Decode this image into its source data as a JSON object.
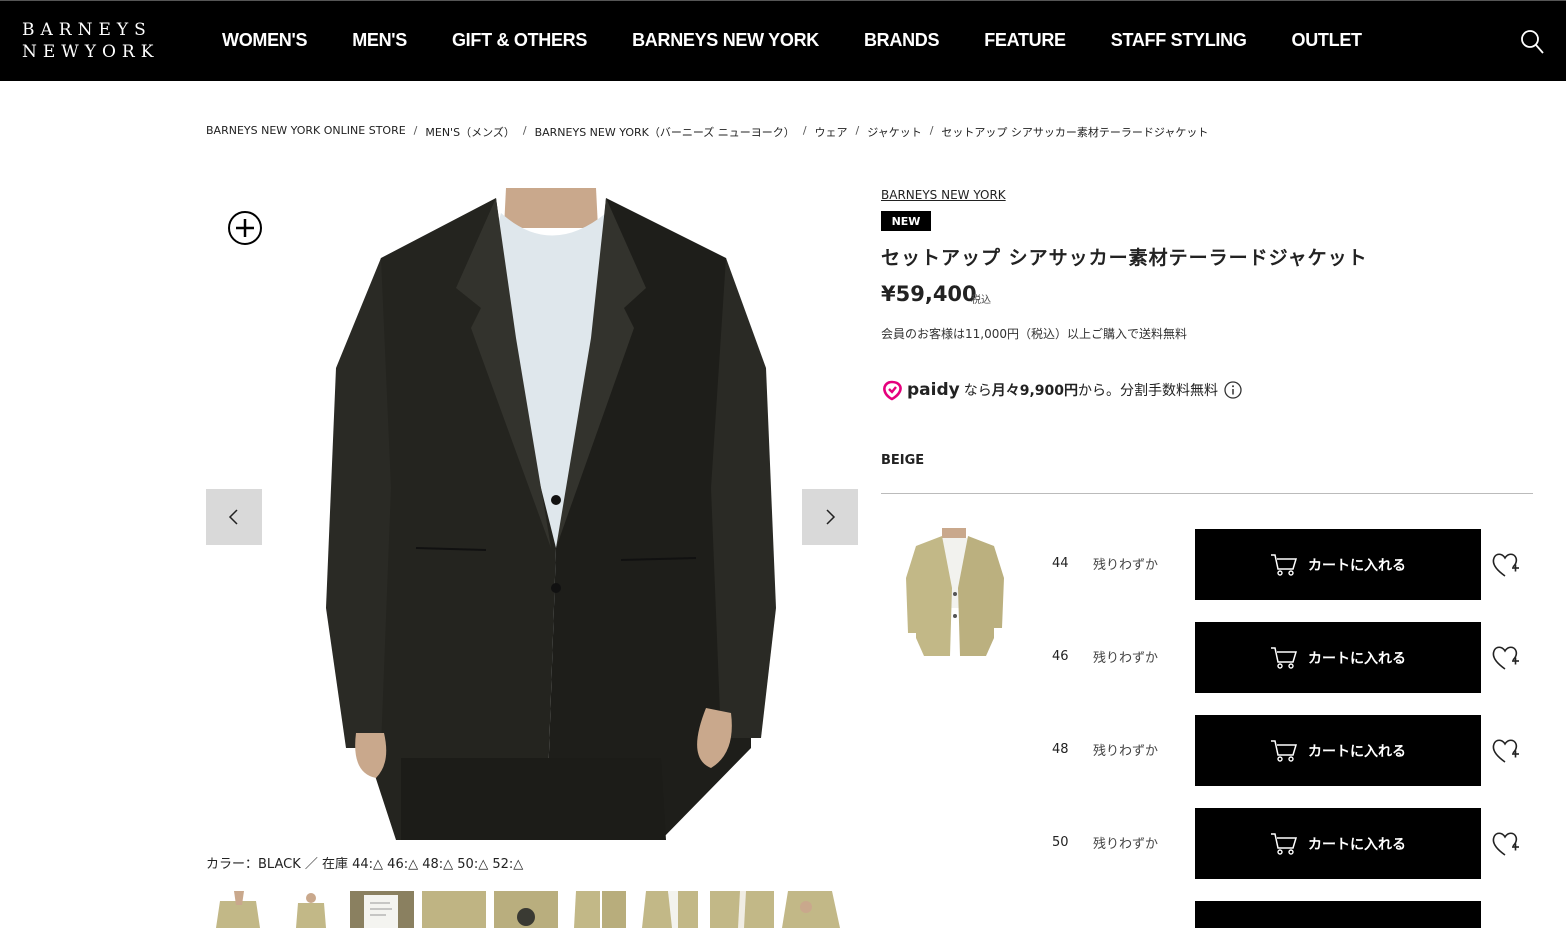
{
  "header": {
    "logo_line1": "BARNEYS",
    "logo_line2": "NEWYORK",
    "nav": [
      "WOMEN'S",
      "MEN'S",
      "GIFT & OTHERS",
      "BARNEYS NEW YORK",
      "BRANDS",
      "FEATURE",
      "STAFF STYLING",
      "OUTLET"
    ],
    "search_icon": "search-icon"
  },
  "breadcrumb": [
    "BARNEYS NEW YORK ONLINE STORE",
    "MEN'S（メンズ）",
    "BARNEYS NEW YORK（バーニーズ ニューヨーク）",
    "ウェア",
    "ジャケット",
    "セットアップ シアサッカー素材テーラードジャケット"
  ],
  "breadcrumb_sep": "/",
  "gallery": {
    "color_stock": "カラー：BLACK ／ 在庫 44:△ 46:△ 48:△ 50:△ 52:△",
    "thumb_count": 9
  },
  "product": {
    "brand": "BARNEYS NEW YORK",
    "badge": "NEW",
    "title": "セットアップ シアサッカー素材テーラードジャケット",
    "price": "¥59,400",
    "tax": "税込",
    "shipping": "会員のお客様は11,000円（税込）以上ご購入で送料無料",
    "paidy_logo": "paidy",
    "paidy_pre": "なら",
    "paidy_amount": "月々9,900円",
    "paidy_post": "から。分割手数料無料",
    "color": "BEIGE"
  },
  "sizes": [
    {
      "size": "44",
      "stock": "残りわずか",
      "cart_label": "カートに入れる"
    },
    {
      "size": "46",
      "stock": "残りわずか",
      "cart_label": "カートに入れる"
    },
    {
      "size": "48",
      "stock": "残りわずか",
      "cart_label": "カートに入れる"
    },
    {
      "size": "50",
      "stock": "残りわずか",
      "cart_label": "カートに入れる"
    }
  ],
  "colors": {
    "header_bg": "#000000",
    "paidy_pink": "#e5007d",
    "beige": "#c2b887"
  }
}
